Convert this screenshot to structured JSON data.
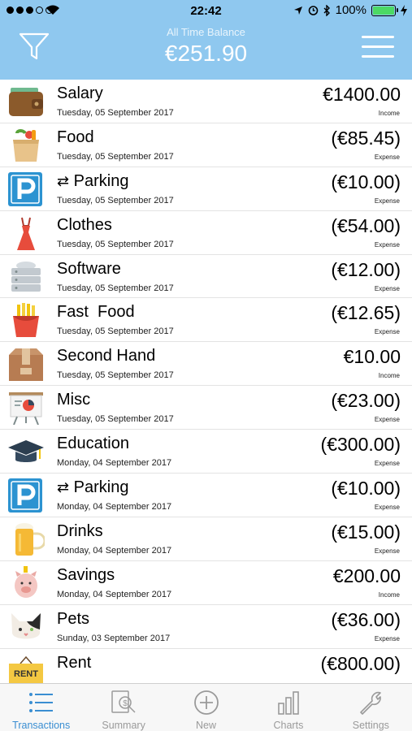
{
  "status_bar": {
    "time": "22:42",
    "battery": "100%"
  },
  "header": {
    "balance_label": "All Time Balance",
    "balance_value": "€251.90"
  },
  "transactions": [
    {
      "name": "Salary",
      "date": "Tuesday, 05 September 2017",
      "amount": "€1400.00",
      "kind": "Income",
      "icon": "wallet-icon",
      "recurring": false
    },
    {
      "name": "Food",
      "date": "Tuesday, 05 September 2017",
      "amount": "(€85.45)",
      "kind": "Expense",
      "icon": "grocery-bag-icon",
      "recurring": false
    },
    {
      "name": "Parking",
      "date": "Tuesday, 05 September 2017",
      "amount": "(€10.00)",
      "kind": "Expense",
      "icon": "parking-icon",
      "recurring": true
    },
    {
      "name": "Clothes",
      "date": "Tuesday, 05 September 2017",
      "amount": "(€54.00)",
      "kind": "Expense",
      "icon": "dress-icon",
      "recurring": false
    },
    {
      "name": "Software",
      "date": "Tuesday, 05 September 2017",
      "amount": "(€12.00)",
      "kind": "Expense",
      "icon": "server-icon",
      "recurring": false
    },
    {
      "name": "Fast  Food",
      "date": "Tuesday, 05 September 2017",
      "amount": "(€12.65)",
      "kind": "Expense",
      "icon": "fries-icon",
      "recurring": false
    },
    {
      "name": "Second Hand",
      "date": "Tuesday, 05 September 2017",
      "amount": "€10.00",
      "kind": "Income",
      "icon": "box-icon",
      "recurring": false
    },
    {
      "name": "Misc",
      "date": "Tuesday, 05 September 2017",
      "amount": "(€23.00)",
      "kind": "Expense",
      "icon": "presentation-icon",
      "recurring": false
    },
    {
      "name": "Education",
      "date": "Monday, 04 September 2017",
      "amount": "(€300.00)",
      "kind": "Expense",
      "icon": "graduation-cap-icon",
      "recurring": false
    },
    {
      "name": "Parking",
      "date": "Monday, 04 September 2017",
      "amount": "(€10.00)",
      "kind": "Expense",
      "icon": "parking-icon",
      "recurring": true
    },
    {
      "name": "Drinks",
      "date": "Monday, 04 September 2017",
      "amount": "(€15.00)",
      "kind": "Expense",
      "icon": "beer-icon",
      "recurring": false
    },
    {
      "name": "Savings",
      "date": "Monday, 04 September 2017",
      "amount": "€200.00",
      "kind": "Income",
      "icon": "piggy-bank-icon",
      "recurring": false
    },
    {
      "name": "Pets",
      "date": "Sunday, 03 September 2017",
      "amount": "(€36.00)",
      "kind": "Expense",
      "icon": "cat-icon",
      "recurring": false
    },
    {
      "name": "Rent",
      "date": "",
      "amount": "(€800.00)",
      "kind": "",
      "icon": "rent-sign-icon",
      "recurring": false,
      "icon_text": "RENT"
    }
  ],
  "tabbar": {
    "tabs": [
      {
        "label": "Transactions",
        "icon": "list-icon",
        "active": true
      },
      {
        "label": "Summary",
        "icon": "summary-icon",
        "active": false
      },
      {
        "label": "New",
        "icon": "plus-circle-icon",
        "active": false
      },
      {
        "label": "Charts",
        "icon": "bar-chart-icon",
        "active": false
      },
      {
        "label": "Settings",
        "icon": "wrench-icon",
        "active": false
      }
    ]
  },
  "colors": {
    "header": "#8fc8ef",
    "active_tab": "#3a8ed2",
    "inactive_tab": "#9a9a9a"
  }
}
